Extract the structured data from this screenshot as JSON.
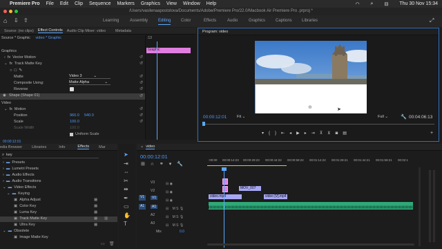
{
  "menubar": {
    "apple": "",
    "app": "Premiere Pro",
    "items": [
      "File",
      "Edit",
      "Clip",
      "Sequence",
      "Markers",
      "Graphics",
      "View",
      "Window",
      "Help"
    ],
    "datetime": "Thu 30 Nov  15:34"
  },
  "titlebar": {
    "path": "/Users/vasilenaapostolova/Documents/Adobe/Premiere Pro/22.0/Macbook Air Premiere Pro .prproj *"
  },
  "workspace": {
    "tabs": [
      "Learning",
      "Assembly",
      "Editing",
      "Color",
      "Effects",
      "Audio",
      "Graphics",
      "Captions",
      "Libraries"
    ],
    "active": "Editing"
  },
  "effect_controls": {
    "tabs": [
      "Source: (no clips)",
      "Effect Controls",
      "Audio Clip Mixer: video",
      "Metadata"
    ],
    "breadcrumb": {
      "source": "Source * Graphic",
      "clip": "video * Graphic"
    },
    "ruler": ":13",
    "clip_label": "Graphic",
    "section_graphics": "Graphics",
    "vector_motion": "Vector Motion",
    "track_matte_key": "Track Matte Key",
    "matte_label": "Matte",
    "matte_value": "Video 3",
    "composite_label": "Composite Using:",
    "composite_value": "Matte Alpha",
    "reverse_label": "Reverse",
    "shape_label": "Shape (Shape 01)",
    "section_video": "Video",
    "motion": "Motion",
    "position_label": "Position",
    "position_x": "960.0",
    "position_y": "540.0",
    "scale_label": "Scale",
    "scale_value": "100.0",
    "scale_width_label": "Scale Width",
    "scale_width_value": "100.0",
    "uniform_scale": "Uniform Scale",
    "timecode": "00:00:12:01"
  },
  "program": {
    "title": "Program: video",
    "timecode": "00:00:12:01",
    "fit": "Fit",
    "quality": "Full",
    "duration": "00:04:06:13"
  },
  "effects_panel": {
    "tabs": [
      "edia Browser",
      "Libraries",
      "Info",
      "Effects",
      "Mar"
    ],
    "search": "key",
    "items": [
      "Presets",
      "Lumetri Presets",
      "Audio Effects",
      "Audio Transitions",
      "Video Effects",
      "Keying",
      "Alpha Adjust",
      "Color Key",
      "Luma Key",
      "Track Matte Key",
      "Ultra Key",
      "Obsolete",
      "Image Matte Key"
    ]
  },
  "timeline": {
    "tab": "video",
    "timecode": "00:00:12:01",
    "ruler": [
      ":00:00",
      "00:00:14:23",
      "00:00:29:23",
      "00:00:44:22",
      "00:00:59:22",
      "00:01:14:22",
      "00:01:29:21",
      "00:01:44:21",
      "00:01:59:21",
      "00:02:1"
    ],
    "tracks": [
      "V3",
      "V2",
      "V1",
      "A1",
      "A2",
      "A3",
      "Mix"
    ],
    "src_v": "V1",
    "src_a": "A1",
    "mix_value": "0.0",
    "clips": {
      "mov": "MOV_007",
      "video1": "video.mp4",
      "video2": "video [V].mp4"
    }
  },
  "colors": {
    "accent": "#5ba8ff",
    "graphic_clip": "#e07de0",
    "video_clip": "#a7a7f5",
    "audio_clip": "#2fa878"
  }
}
